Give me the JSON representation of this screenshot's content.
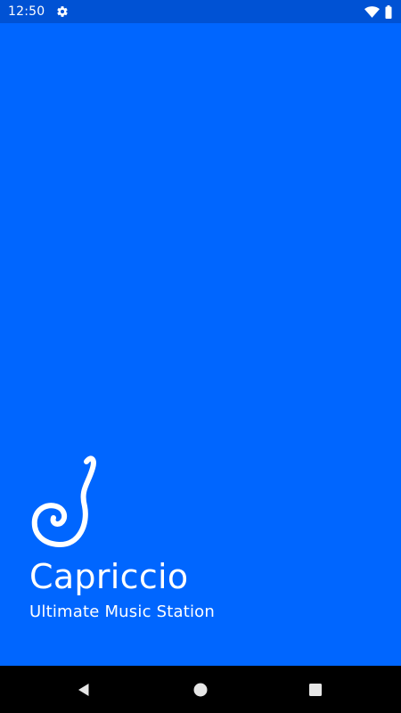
{
  "status_bar": {
    "time": "12:50",
    "icons": [
      "settings-icon",
      "wifi-icon",
      "battery-icon"
    ]
  },
  "splash": {
    "logo_icon": "swirl-logo-icon",
    "title": "Capriccio",
    "subtitle": "Ultimate Music Station"
  },
  "nav_bar": {
    "icons": [
      "back-triangle-icon",
      "home-circle-icon",
      "recents-square-icon"
    ]
  },
  "colors": {
    "background": "#0066FF",
    "status_bar": "#0052D4",
    "nav_bar": "#000000",
    "foreground": "#FFFFFF"
  }
}
